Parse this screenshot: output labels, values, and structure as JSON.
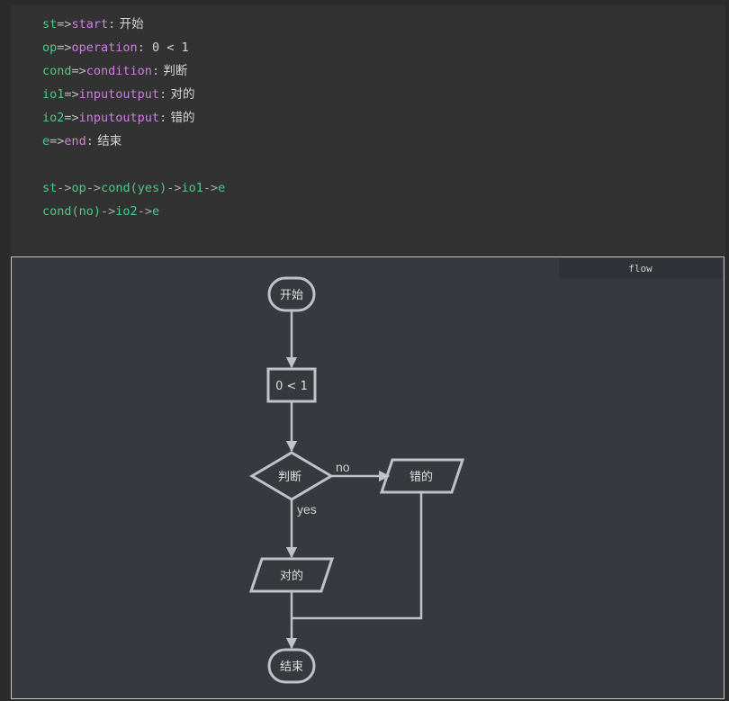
{
  "code": {
    "line1": {
      "key": "st",
      "arrow": "=>",
      "type": "start",
      "colon": ":",
      "text": " 开始"
    },
    "line2": {
      "key": "op",
      "arrow": "=>",
      "type": "operation",
      "colon": ":",
      "text": " 0 < 1"
    },
    "line3": {
      "key": "cond",
      "arrow": "=>",
      "type": "condition",
      "colon": ":",
      "text": " 判断"
    },
    "line4": {
      "key": "io1",
      "arrow": "=>",
      "type": "inputoutput",
      "colon": ":",
      "text": " 对的"
    },
    "line5": {
      "key": "io2",
      "arrow": "=>",
      "type": "inputoutput",
      "colon": ":",
      "text": " 错的"
    },
    "line6": {
      "key": "e",
      "arrow": "=>",
      "type": "end",
      "colon": ":",
      "text": " 结束"
    },
    "flow1": {
      "a": "st",
      "b": "->",
      "c": "op",
      "d": "->",
      "e": "cond(yes)",
      "f": "->",
      "g": "io1",
      "h": "->",
      "i": "e"
    },
    "flow2": {
      "a": "cond(no)",
      "b": "->",
      "c": "io2",
      "d": "->",
      "e": "e"
    }
  },
  "tab": {
    "label": "flow"
  },
  "diagram": {
    "nodes": {
      "start": "开始",
      "operation": "0 < 1",
      "condition": "判断",
      "io_yes": "对的",
      "io_no": "错的",
      "end": "结束"
    },
    "edges": {
      "yes_label": "yes",
      "no_label": "no"
    },
    "stroke_color": "#bfc3c7",
    "background": "#363a3e"
  }
}
